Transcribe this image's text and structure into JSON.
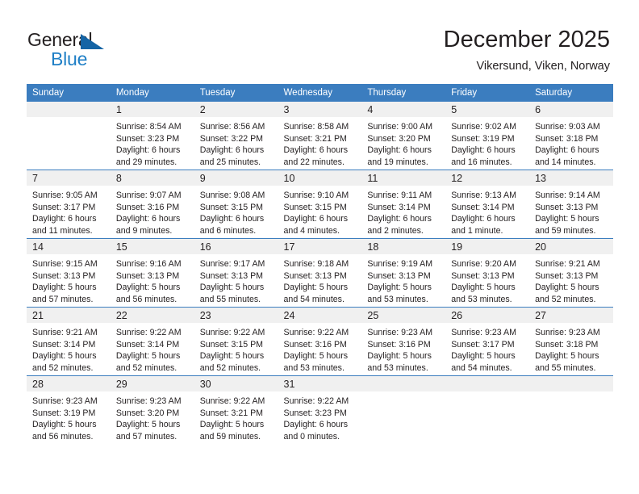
{
  "logo": {
    "text_top": "General",
    "text_bottom": "Blue"
  },
  "header": {
    "title": "December 2025",
    "subtitle": "Vikersund, Viken, Norway"
  },
  "colors": {
    "header_blue": "#3b7dbf",
    "logo_blue": "#1f7fc6",
    "daynum_band": "#f0f0f0",
    "text": "#231f20"
  },
  "weekdays": [
    "Sunday",
    "Monday",
    "Tuesday",
    "Wednesday",
    "Thursday",
    "Friday",
    "Saturday"
  ],
  "weeks": [
    [
      {
        "day": "",
        "sunrise": "",
        "sunset": "",
        "daylight1": "",
        "daylight2": ""
      },
      {
        "day": "1",
        "sunrise": "Sunrise: 8:54 AM",
        "sunset": "Sunset: 3:23 PM",
        "daylight1": "Daylight: 6 hours",
        "daylight2": "and 29 minutes."
      },
      {
        "day": "2",
        "sunrise": "Sunrise: 8:56 AM",
        "sunset": "Sunset: 3:22 PM",
        "daylight1": "Daylight: 6 hours",
        "daylight2": "and 25 minutes."
      },
      {
        "day": "3",
        "sunrise": "Sunrise: 8:58 AM",
        "sunset": "Sunset: 3:21 PM",
        "daylight1": "Daylight: 6 hours",
        "daylight2": "and 22 minutes."
      },
      {
        "day": "4",
        "sunrise": "Sunrise: 9:00 AM",
        "sunset": "Sunset: 3:20 PM",
        "daylight1": "Daylight: 6 hours",
        "daylight2": "and 19 minutes."
      },
      {
        "day": "5",
        "sunrise": "Sunrise: 9:02 AM",
        "sunset": "Sunset: 3:19 PM",
        "daylight1": "Daylight: 6 hours",
        "daylight2": "and 16 minutes."
      },
      {
        "day": "6",
        "sunrise": "Sunrise: 9:03 AM",
        "sunset": "Sunset: 3:18 PM",
        "daylight1": "Daylight: 6 hours",
        "daylight2": "and 14 minutes."
      }
    ],
    [
      {
        "day": "7",
        "sunrise": "Sunrise: 9:05 AM",
        "sunset": "Sunset: 3:17 PM",
        "daylight1": "Daylight: 6 hours",
        "daylight2": "and 11 minutes."
      },
      {
        "day": "8",
        "sunrise": "Sunrise: 9:07 AM",
        "sunset": "Sunset: 3:16 PM",
        "daylight1": "Daylight: 6 hours",
        "daylight2": "and 9 minutes."
      },
      {
        "day": "9",
        "sunrise": "Sunrise: 9:08 AM",
        "sunset": "Sunset: 3:15 PM",
        "daylight1": "Daylight: 6 hours",
        "daylight2": "and 6 minutes."
      },
      {
        "day": "10",
        "sunrise": "Sunrise: 9:10 AM",
        "sunset": "Sunset: 3:15 PM",
        "daylight1": "Daylight: 6 hours",
        "daylight2": "and 4 minutes."
      },
      {
        "day": "11",
        "sunrise": "Sunrise: 9:11 AM",
        "sunset": "Sunset: 3:14 PM",
        "daylight1": "Daylight: 6 hours",
        "daylight2": "and 2 minutes."
      },
      {
        "day": "12",
        "sunrise": "Sunrise: 9:13 AM",
        "sunset": "Sunset: 3:14 PM",
        "daylight1": "Daylight: 6 hours",
        "daylight2": "and 1 minute."
      },
      {
        "day": "13",
        "sunrise": "Sunrise: 9:14 AM",
        "sunset": "Sunset: 3:13 PM",
        "daylight1": "Daylight: 5 hours",
        "daylight2": "and 59 minutes."
      }
    ],
    [
      {
        "day": "14",
        "sunrise": "Sunrise: 9:15 AM",
        "sunset": "Sunset: 3:13 PM",
        "daylight1": "Daylight: 5 hours",
        "daylight2": "and 57 minutes."
      },
      {
        "day": "15",
        "sunrise": "Sunrise: 9:16 AM",
        "sunset": "Sunset: 3:13 PM",
        "daylight1": "Daylight: 5 hours",
        "daylight2": "and 56 minutes."
      },
      {
        "day": "16",
        "sunrise": "Sunrise: 9:17 AM",
        "sunset": "Sunset: 3:13 PM",
        "daylight1": "Daylight: 5 hours",
        "daylight2": "and 55 minutes."
      },
      {
        "day": "17",
        "sunrise": "Sunrise: 9:18 AM",
        "sunset": "Sunset: 3:13 PM",
        "daylight1": "Daylight: 5 hours",
        "daylight2": "and 54 minutes."
      },
      {
        "day": "18",
        "sunrise": "Sunrise: 9:19 AM",
        "sunset": "Sunset: 3:13 PM",
        "daylight1": "Daylight: 5 hours",
        "daylight2": "and 53 minutes."
      },
      {
        "day": "19",
        "sunrise": "Sunrise: 9:20 AM",
        "sunset": "Sunset: 3:13 PM",
        "daylight1": "Daylight: 5 hours",
        "daylight2": "and 53 minutes."
      },
      {
        "day": "20",
        "sunrise": "Sunrise: 9:21 AM",
        "sunset": "Sunset: 3:13 PM",
        "daylight1": "Daylight: 5 hours",
        "daylight2": "and 52 minutes."
      }
    ],
    [
      {
        "day": "21",
        "sunrise": "Sunrise: 9:21 AM",
        "sunset": "Sunset: 3:14 PM",
        "daylight1": "Daylight: 5 hours",
        "daylight2": "and 52 minutes."
      },
      {
        "day": "22",
        "sunrise": "Sunrise: 9:22 AM",
        "sunset": "Sunset: 3:14 PM",
        "daylight1": "Daylight: 5 hours",
        "daylight2": "and 52 minutes."
      },
      {
        "day": "23",
        "sunrise": "Sunrise: 9:22 AM",
        "sunset": "Sunset: 3:15 PM",
        "daylight1": "Daylight: 5 hours",
        "daylight2": "and 52 minutes."
      },
      {
        "day": "24",
        "sunrise": "Sunrise: 9:22 AM",
        "sunset": "Sunset: 3:16 PM",
        "daylight1": "Daylight: 5 hours",
        "daylight2": "and 53 minutes."
      },
      {
        "day": "25",
        "sunrise": "Sunrise: 9:23 AM",
        "sunset": "Sunset: 3:16 PM",
        "daylight1": "Daylight: 5 hours",
        "daylight2": "and 53 minutes."
      },
      {
        "day": "26",
        "sunrise": "Sunrise: 9:23 AM",
        "sunset": "Sunset: 3:17 PM",
        "daylight1": "Daylight: 5 hours",
        "daylight2": "and 54 minutes."
      },
      {
        "day": "27",
        "sunrise": "Sunrise: 9:23 AM",
        "sunset": "Sunset: 3:18 PM",
        "daylight1": "Daylight: 5 hours",
        "daylight2": "and 55 minutes."
      }
    ],
    [
      {
        "day": "28",
        "sunrise": "Sunrise: 9:23 AM",
        "sunset": "Sunset: 3:19 PM",
        "daylight1": "Daylight: 5 hours",
        "daylight2": "and 56 minutes."
      },
      {
        "day": "29",
        "sunrise": "Sunrise: 9:23 AM",
        "sunset": "Sunset: 3:20 PM",
        "daylight1": "Daylight: 5 hours",
        "daylight2": "and 57 minutes."
      },
      {
        "day": "30",
        "sunrise": "Sunrise: 9:22 AM",
        "sunset": "Sunset: 3:21 PM",
        "daylight1": "Daylight: 5 hours",
        "daylight2": "and 59 minutes."
      },
      {
        "day": "31",
        "sunrise": "Sunrise: 9:22 AM",
        "sunset": "Sunset: 3:23 PM",
        "daylight1": "Daylight: 6 hours",
        "daylight2": "and 0 minutes."
      },
      {
        "day": "",
        "sunrise": "",
        "sunset": "",
        "daylight1": "",
        "daylight2": ""
      },
      {
        "day": "",
        "sunrise": "",
        "sunset": "",
        "daylight1": "",
        "daylight2": ""
      },
      {
        "day": "",
        "sunrise": "",
        "sunset": "",
        "daylight1": "",
        "daylight2": ""
      }
    ]
  ]
}
